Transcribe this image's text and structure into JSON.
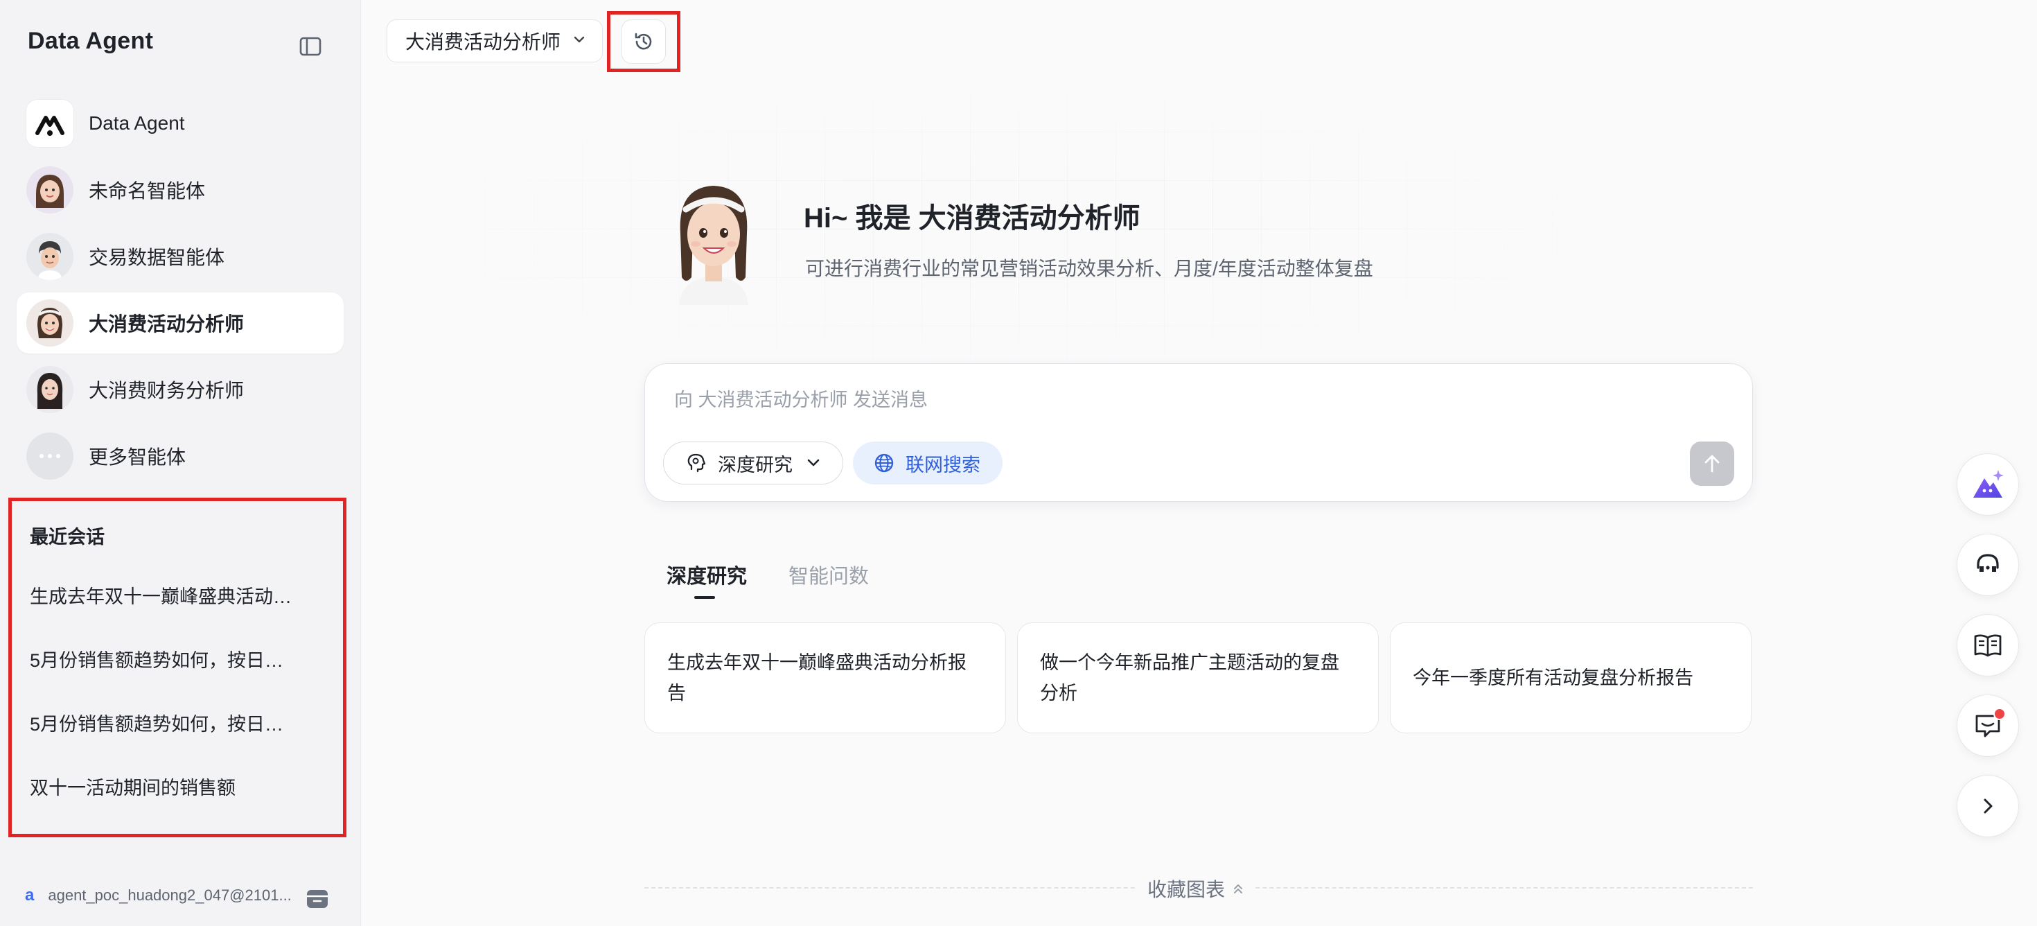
{
  "app": {
    "title": "Data Agent"
  },
  "sidebar": {
    "agents": [
      {
        "label": "Data Agent",
        "icon": "data-agent-logo-icon"
      },
      {
        "label": "未命名智能体",
        "icon": "avatar-girl-icon"
      },
      {
        "label": "交易数据智能体",
        "icon": "avatar-boy-icon"
      },
      {
        "label": "大消费活动分析师",
        "icon": "avatar-girl-headband-icon",
        "active": true
      },
      {
        "label": "大消费财务分析师",
        "icon": "avatar-woman-icon"
      },
      {
        "label": "更多智能体",
        "icon": "more-dots-icon"
      }
    ],
    "recent": {
      "title": "最近会话",
      "items": [
        "生成去年双十一巅峰盛典活动…",
        "5月份销售额趋势如何，按日…",
        "5月份销售额趋势如何，按日…",
        "双十一活动期间的销售额"
      ]
    },
    "account": {
      "initial": "a",
      "name": "agent_poc_huadong2_047@2101..."
    }
  },
  "topbar": {
    "agent_select": "大消费活动分析师"
  },
  "hero": {
    "greeting": "Hi~ 我是 大消费活动分析师",
    "subtitle": "可进行消费行业的常见营销活动效果分析、月度/年度活动整体复盘"
  },
  "composer": {
    "placeholder": "向 大消费活动分析师 发送消息",
    "mode_label": "深度研究",
    "web_search_label": "联网搜索"
  },
  "tabs": [
    {
      "label": "深度研究",
      "active": true
    },
    {
      "label": "智能问数",
      "active": false
    }
  ],
  "suggestions": [
    "生成去年双十一巅峰盛典活动分析报告",
    "做一个今年新品推广主题活动的复盘分析",
    "今年一季度所有活动复盘分析报告"
  ],
  "footer": {
    "label": "收藏图表"
  },
  "colors": {
    "accent": "#2f5fd7",
    "highlight": "#e02424",
    "badge": "#ef4444"
  }
}
